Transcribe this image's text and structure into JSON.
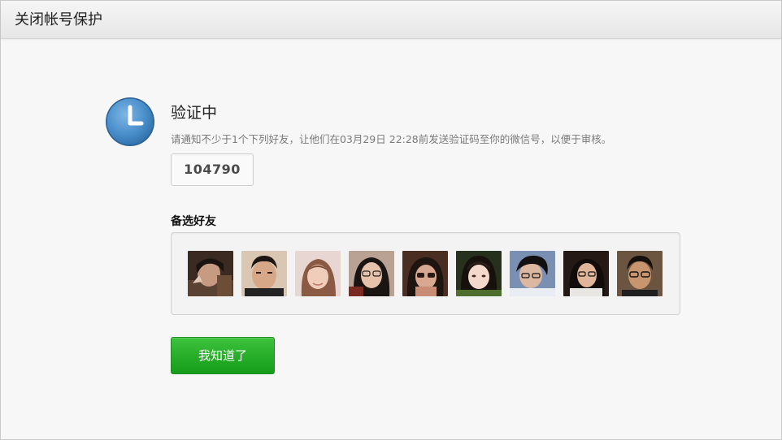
{
  "window": {
    "title": "关闭帐号保护"
  },
  "verification": {
    "status_title": "验证中",
    "instruction": "请通知不少于1个下列好友，让他们在03月29日 22:28前发送验证码至你的微信号，以便于审核。",
    "code": "104790"
  },
  "friends": {
    "label": "备选好友",
    "items": [
      {
        "name": "friend-1"
      },
      {
        "name": "friend-2"
      },
      {
        "name": "friend-3"
      },
      {
        "name": "friend-4"
      },
      {
        "name": "friend-5"
      },
      {
        "name": "friend-6"
      },
      {
        "name": "friend-7"
      },
      {
        "name": "friend-8"
      },
      {
        "name": "friend-9"
      }
    ]
  },
  "actions": {
    "confirm_label": "我知道了"
  },
  "colors": {
    "accent_green": "#1a9f1c",
    "clock_blue": "#3f87c4"
  },
  "icons": {
    "status": "clock-icon"
  }
}
